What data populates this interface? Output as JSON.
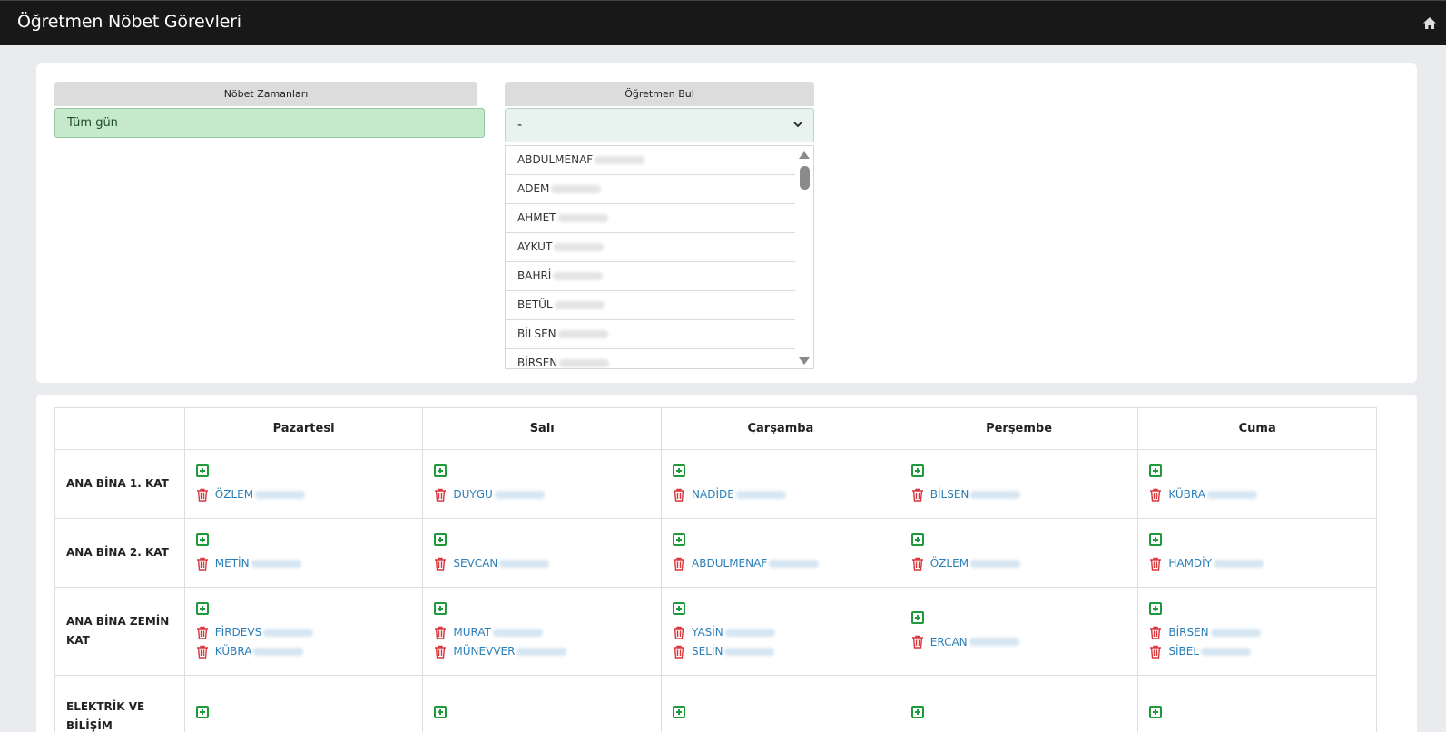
{
  "header": {
    "title": "Öğretmen Nöbet Görevleri"
  },
  "panels": {
    "times_header": "Nöbet Zamanları",
    "time_value": "Tüm gün",
    "teacher_header": "Öğretmen Bul",
    "teacher_selected": "-",
    "teacher_options": [
      "ABDULMENAF",
      "ADEM",
      "AHMET",
      "AYKUT",
      "BAHRİ",
      "BETÜL",
      "BİLSEN",
      "BİRSEN"
    ]
  },
  "schedule": {
    "days": [
      "Pazartesi",
      "Salı",
      "Çarşamba",
      "Perşembe",
      "Cuma"
    ],
    "rows": [
      {
        "label": "ANA BİNA 1. KAT",
        "cells": [
          [
            "ÖZLEM"
          ],
          [
            "DUYGU"
          ],
          [
            "NADİDE"
          ],
          [
            "BİLSEN"
          ],
          [
            "KÜBRA"
          ]
        ]
      },
      {
        "label": "ANA BİNA 2. KAT",
        "cells": [
          [
            "METİN"
          ],
          [
            "SEVCAN"
          ],
          [
            "ABDULMENAF"
          ],
          [
            "ÖZLEM"
          ],
          [
            "HAMDİY"
          ]
        ]
      },
      {
        "label": "ANA BİNA ZEMİN KAT",
        "cells": [
          [
            "FİRDEVS",
            "KÜBRA"
          ],
          [
            "MURAT",
            "MÜNEVVER"
          ],
          [
            "YASİN",
            "SELİN"
          ],
          [
            "ERCAN"
          ],
          [
            "BİRSEN",
            "SİBEL"
          ]
        ]
      },
      {
        "label": "ELEKTRİK VE BİLİŞİM",
        "cells": [
          [],
          [],
          [],
          [],
          []
        ]
      }
    ]
  },
  "colors": {
    "add": "#1e9a3c",
    "remove": "#d9363e",
    "name": "#2a7fb8"
  }
}
